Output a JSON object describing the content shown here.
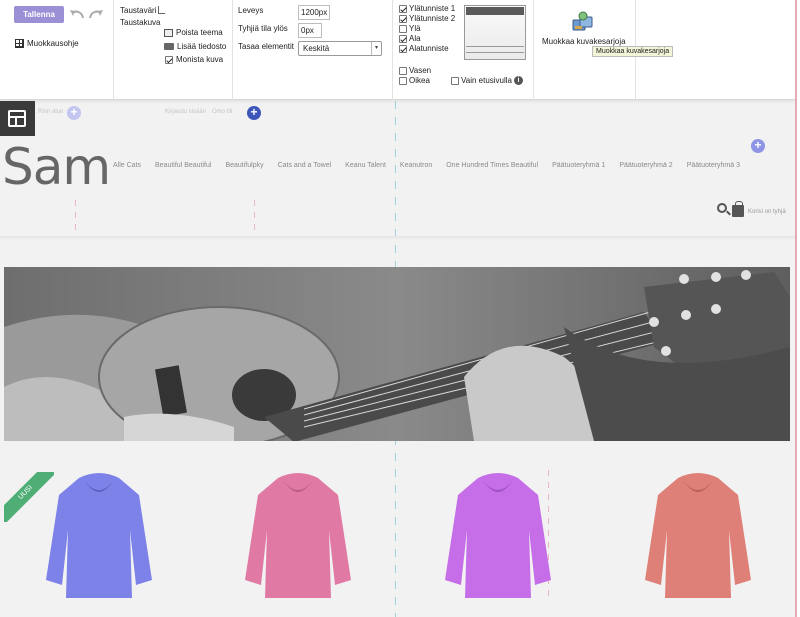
{
  "toolbar": {
    "save_label": "Tallenna",
    "guide_label": "Muokkausohje",
    "background_color_label": "Taustaväri",
    "background_image_label": "Taustakuva",
    "remove_theme_label": "Poista teema",
    "add_file_label": "Lisää tiedosto",
    "duplicate_image_label": "Monista kuva",
    "width_label": "Leveys",
    "width_value": "1200px",
    "top_space_label": "Tyhjiä tila ylös",
    "top_space_value": "0px",
    "align_label": "Tasaa elementit",
    "align_value": "Keskitä",
    "header1_label": "Ylätunniste 1",
    "header2_label": "Ylätunniste 2",
    "top_label": "Ylä",
    "bottom_label": "Ala",
    "footer_label": "Alatunniste",
    "left_label": "Vasen",
    "right_label": "Oikea",
    "front_page_only_label": "Vain etusivulla",
    "edit_galleries_label": "Muokkaa kuvakesarjoja",
    "tooltip": "Muokkaa kuvakesarjoja"
  },
  "checkbox_states": {
    "header1": true,
    "header2": true,
    "top": false,
    "bottom": true,
    "footer": true,
    "left": false,
    "right": false,
    "front_page_only": false,
    "duplicate_image": true
  },
  "page": {
    "faint_top_left": "Rinn alue",
    "faint_top_mid": "Kirjaudu sisään",
    "faint_top_right": "Omo tili",
    "logo": "Sam",
    "nav_items": [
      "Alle Cats",
      "Beautiful Beautiful",
      "Beautifulpky",
      "Cats and a Towel",
      "Keanu Talent",
      "Keanutron",
      "One Hundred Times Beautiful",
      "Päätuoteryhmä 1",
      "Päätuoteryhmä 2",
      "Päätuoteryhmä 3"
    ],
    "cart_text": "Korisi on tyhjä",
    "new_badge": "UUSI"
  },
  "colors": {
    "save_button": "#9b8fd6",
    "plus_button": "#8f95e6",
    "new_badge": "#4fae76",
    "product_colors": [
      "#7c82e8",
      "#e07aa5",
      "#c56ee8",
      "#de8078"
    ]
  },
  "icons": {
    "undo": "undo-icon",
    "redo": "redo-icon",
    "grid": "grid-icon",
    "search": "search-icon",
    "cart": "shopping-bag-icon",
    "info": "info-icon",
    "gallery": "gallery-icon",
    "layout": "layout-icon"
  }
}
